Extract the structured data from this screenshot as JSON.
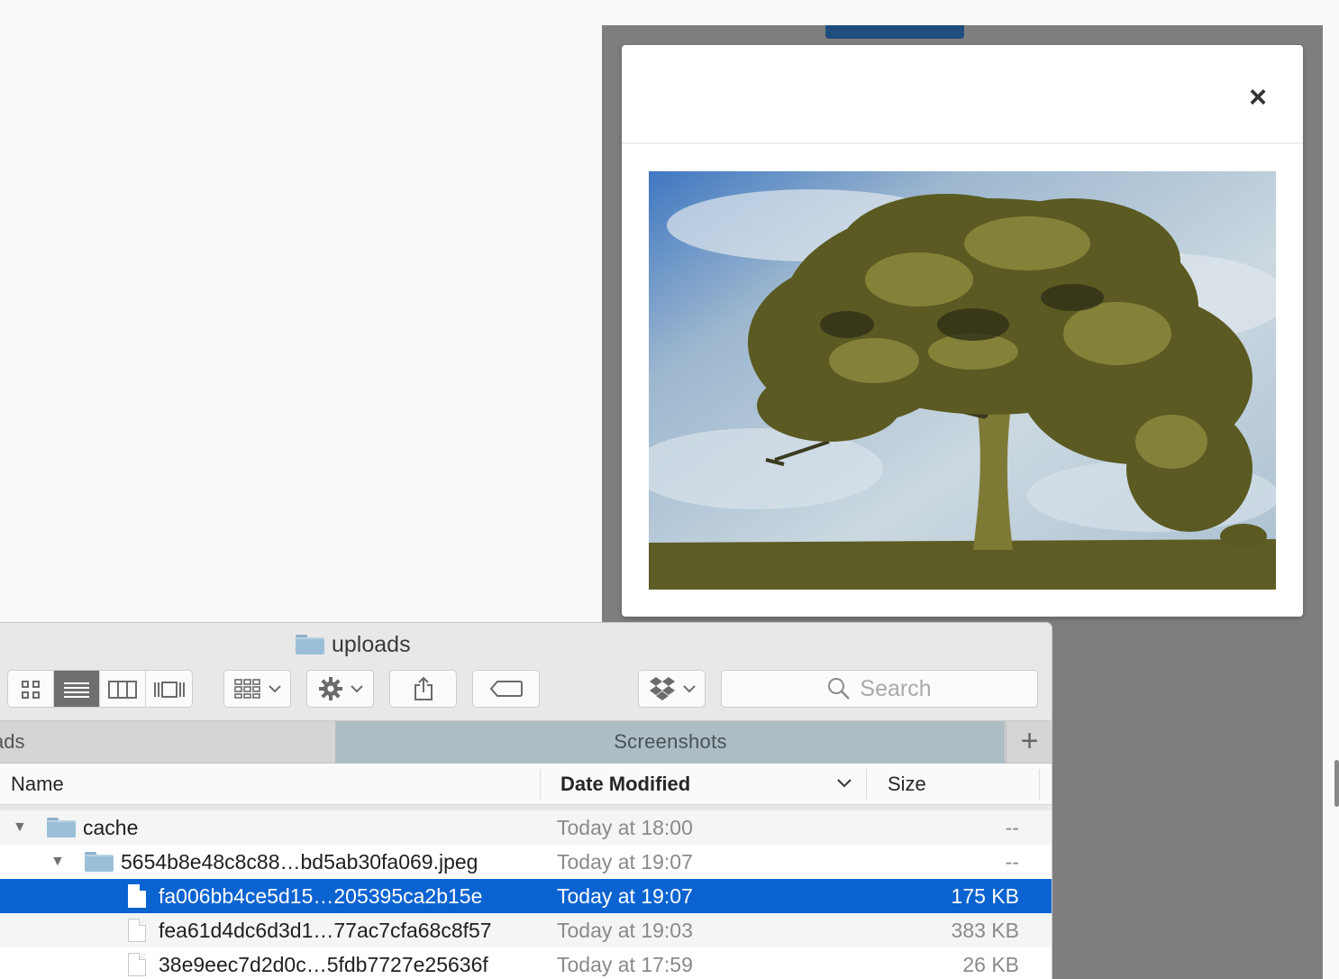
{
  "modal": {
    "close_label": "×"
  },
  "finder": {
    "title": "uploads",
    "search": {
      "placeholder": "Search"
    },
    "tabs": [
      {
        "label": "ads"
      },
      {
        "label": "Screenshots"
      }
    ],
    "add_tab_label": "+",
    "columns": {
      "name": "Name",
      "date": "Date Modified",
      "size": "Size"
    },
    "rows": [
      {
        "name": "cache",
        "date": "Today at 18:00",
        "size": "--"
      },
      {
        "name": "5654b8e48c8c88…bd5ab30fa069.jpeg",
        "date": "Today at 19:07",
        "size": "--"
      },
      {
        "name": "fa006bb4ce5d15…205395ca2b15e",
        "date": "Today at 19:07",
        "size": "175 KB"
      },
      {
        "name": "fea61d4dc6d3d1…77ac7cfa68c8f57",
        "date": "Today at 19:03",
        "size": "383 KB"
      },
      {
        "name": "38e9eec7d2d0c…5fdb7727e25636f",
        "date": "Today at 17:59",
        "size": "26 KB"
      }
    ]
  },
  "colors": {
    "selection": "#0b63d1",
    "overlay": "#7f7e7f",
    "active_tab": "#adbdc4"
  }
}
